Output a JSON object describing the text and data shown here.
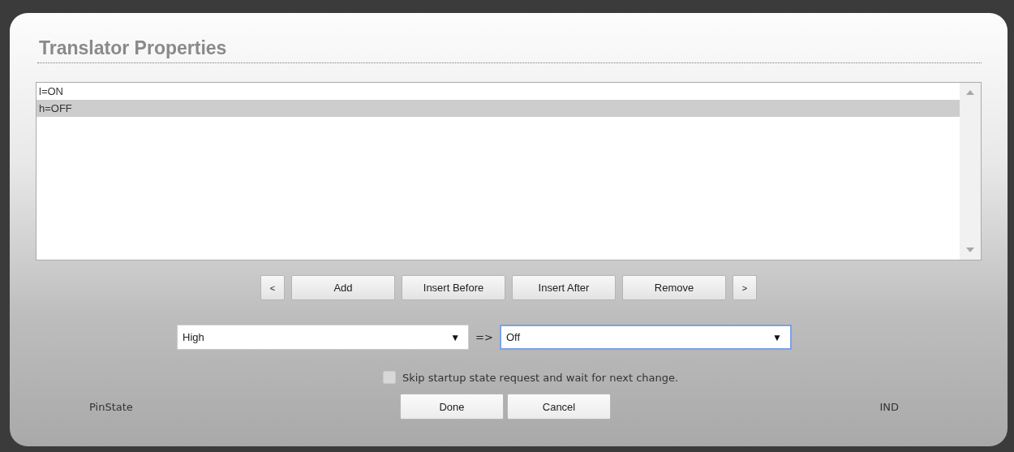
{
  "dialog": {
    "title": "Translator Properties"
  },
  "list": {
    "items": [
      {
        "text": "l=ON",
        "selected": false
      },
      {
        "text": "h=OFF",
        "selected": true
      }
    ]
  },
  "list_buttons": [
    {
      "label": "<",
      "kind": "small"
    },
    {
      "label": "Add",
      "kind": "wide"
    },
    {
      "label": "Insert Before",
      "kind": "wide"
    },
    {
      "label": "Insert After",
      "kind": "wide"
    },
    {
      "label": "Remove",
      "kind": "wide"
    },
    {
      "label": ">",
      "kind": "small"
    }
  ],
  "mapping": {
    "from": {
      "value": "High",
      "focused": false
    },
    "arrow": "=>",
    "to": {
      "value": "Off",
      "focused": true
    },
    "caret": "▼"
  },
  "skip_startup": {
    "label": "Skip startup state request and wait for next change.",
    "checked": false
  },
  "footer": {
    "left": "PinState",
    "buttons": [
      "Done",
      "Cancel"
    ],
    "right": "IND"
  }
}
